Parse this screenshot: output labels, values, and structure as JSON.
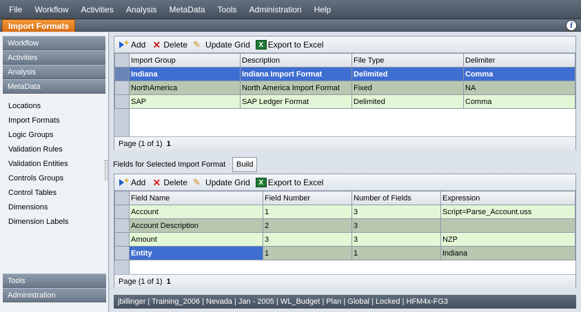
{
  "menu": [
    "File",
    "Workflow",
    "Activities",
    "Analysis",
    "MetaData",
    "Tools",
    "Administration",
    "Help"
  ],
  "active_tab": "Import Formats",
  "sidebar": {
    "sections_top": [
      "Workflow",
      "Activities",
      "Analysis",
      "MetaData"
    ],
    "items": [
      "Locations",
      "Import Formats",
      "Logic Groups",
      "Validation Rules",
      "Validation Entities",
      "Controls Groups",
      "Control Tables",
      "Dimensions",
      "Dimension Labels"
    ],
    "sections_bottom": [
      "Tools",
      "Administration"
    ]
  },
  "toolbar": {
    "add": "Add",
    "delete": "Delete",
    "update": "Update Grid",
    "export": "Export to Excel"
  },
  "formats_grid": {
    "headers": [
      "Import Group",
      "Description",
      "File Type",
      "Delimiter"
    ],
    "rows": [
      [
        "Indiana",
        "Indiana Import Format",
        "Delimited",
        "Comma"
      ],
      [
        "NorthAmerica",
        "North America Import Format",
        "Fixed",
        "NA"
      ],
      [
        "SAP",
        "SAP Ledger Format",
        "Delimited",
        "Comma"
      ]
    ],
    "pager": {
      "label": "Page (1 of 1)",
      "page": "1"
    }
  },
  "fields_section": {
    "label": "Fields for Selected Import Format",
    "build": "Build"
  },
  "fields_grid": {
    "headers": [
      "Field Name",
      "Field Number",
      "Number of Fields",
      "Expression"
    ],
    "rows": [
      [
        "Account",
        "1",
        "3",
        "Script=Parse_Account.uss"
      ],
      [
        "Account Description",
        "2",
        "3",
        ""
      ],
      [
        "Amount",
        "3",
        "3",
        "NZP"
      ],
      [
        "Entity",
        "1",
        "1",
        "Indiana"
      ]
    ],
    "pager": {
      "label": "Page (1 of 1)",
      "page": "1"
    }
  },
  "status": "jbillinger  |  Training_2006  |  Nevada  |  Jan - 2005  |  WL_Budget  |  Plan  |  Global  |  Locked  |  HFM4x-FG3"
}
